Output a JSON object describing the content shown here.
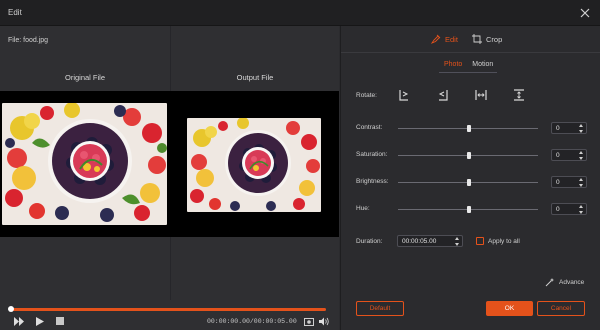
{
  "window": {
    "title": "Edit"
  },
  "preview": {
    "file_label": "File:  food.jpg",
    "original_title": "Original File",
    "output_title": "Output File"
  },
  "player": {
    "time": "00:00:00.00/00:00:05.00",
    "progress": 1.0
  },
  "tabs": {
    "edit": "Edit",
    "crop": "Crop"
  },
  "subtabs": {
    "photo": "Photo",
    "motion": "Motion"
  },
  "adjust": {
    "rotate_label": "Rotate:",
    "contrast_label": "Contrast:",
    "contrast_value": "0",
    "saturation_label": "Saturation:",
    "saturation_value": "0",
    "brightness_label": "Brightness:",
    "brightness_value": "0",
    "hue_label": "Hue:",
    "hue_value": "0",
    "duration_label": "Duration:",
    "duration_value": "00:00:05.00",
    "apply_all": "Apply to all",
    "advance": "Advance"
  },
  "buttons": {
    "default": "Default",
    "ok": "OK",
    "cancel": "Cancel"
  },
  "colors": {
    "accent": "#e4521b",
    "panel": "#2b2b2e",
    "video_bg": "#000000"
  }
}
